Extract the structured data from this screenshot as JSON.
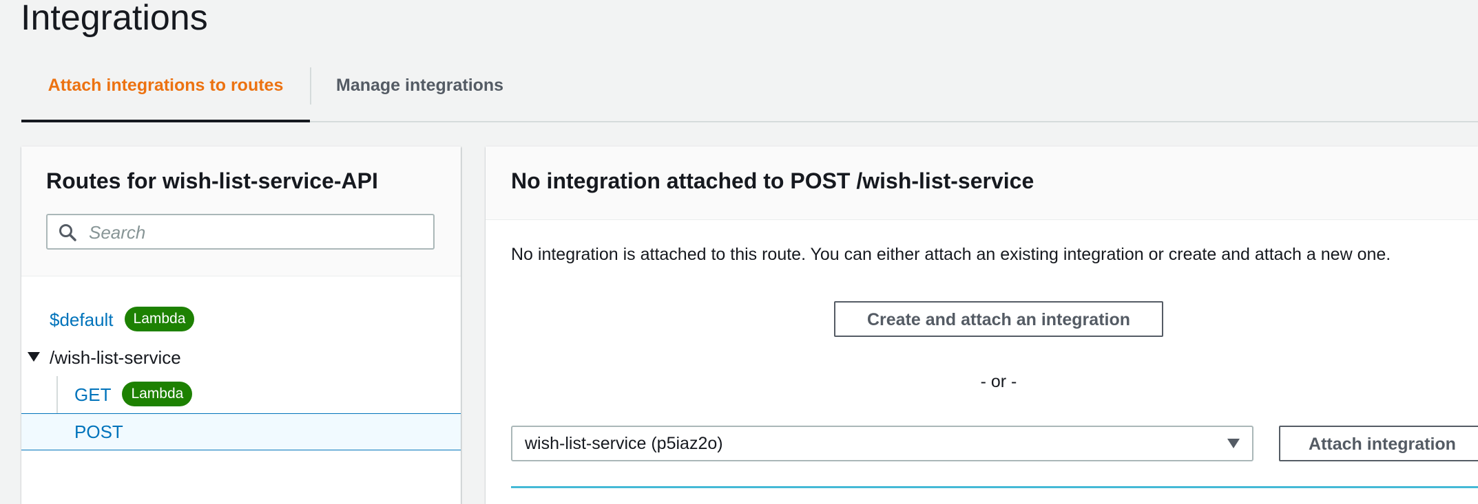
{
  "page": {
    "title": "Integrations"
  },
  "tabs": [
    {
      "label": "Attach integrations to routes",
      "active": true
    },
    {
      "label": "Manage integrations",
      "active": false
    }
  ],
  "routes_panel": {
    "title": "Routes for wish-list-service-API",
    "search": {
      "placeholder": "Search",
      "value": ""
    },
    "routes": [
      {
        "label": "$default",
        "badge": "Lambda"
      },
      {
        "label": "/wish-list-service",
        "expanded": true,
        "children": [
          {
            "label": "GET",
            "badge": "Lambda"
          },
          {
            "label": "POST",
            "selected": true
          }
        ]
      }
    ]
  },
  "detail_panel": {
    "title": "No integration attached to POST /wish-list-service",
    "description": "No integration is attached to this route. You can either attach an existing integration or create and attach a new one.",
    "create_button": "Create and attach an integration",
    "or_text": "- or -",
    "select_value": "wish-list-service (p5iaz2o)",
    "attach_button": "Attach integration"
  },
  "colors": {
    "accent": "#ec7211",
    "link": "#0073bb",
    "badge": "#1d8102",
    "selected_bg": "#f1faff"
  }
}
